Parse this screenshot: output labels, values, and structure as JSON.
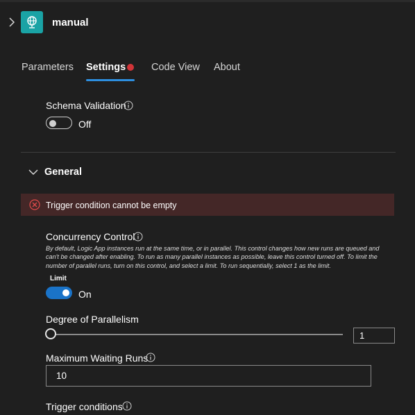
{
  "header": {
    "title": "manual"
  },
  "tabs": [
    {
      "label": "Parameters"
    },
    {
      "label": "Settings"
    },
    {
      "label": "Code View"
    },
    {
      "label": "About"
    }
  ],
  "schema_validation": {
    "label": "Schema Validation",
    "state_text": "Off",
    "enabled": false
  },
  "general": {
    "title": "General",
    "error": "Trigger condition cannot be empty",
    "concurrency": {
      "label": "Concurrency Control",
      "description": "By default, Logic App instances run at the same time, or in parallel. This control changes how new runs are queued and can't be changed after enabling. To run as many parallel instances as possible, leave this control turned off. To limit the number of parallel runs, turn on this control, and select a limit. To run sequentially, select 1 as the limit.",
      "limit_label": "Limit",
      "state_text": "On",
      "enabled": true
    },
    "parallelism": {
      "label": "Degree of Parallelism",
      "value": "1"
    },
    "max_waiting": {
      "label": "Maximum Waiting Runs",
      "value": "10"
    },
    "trigger_conditions": {
      "label": "Trigger conditions"
    }
  },
  "colors": {
    "background": "#1f1f1f",
    "accent": "#2d8fe0",
    "toggle_on": "#1a73c8",
    "error_bg": "#442727",
    "error_icon": "#e24b4b",
    "app_icon_bg": "#1aa3a5",
    "unsaved_dot": "#d13438"
  },
  "icons": {
    "expand": "chevron-right-icon",
    "app": "globe-icon",
    "info": "info-icon",
    "collapse": "chevron-down-icon",
    "error": "error-circle-icon"
  }
}
